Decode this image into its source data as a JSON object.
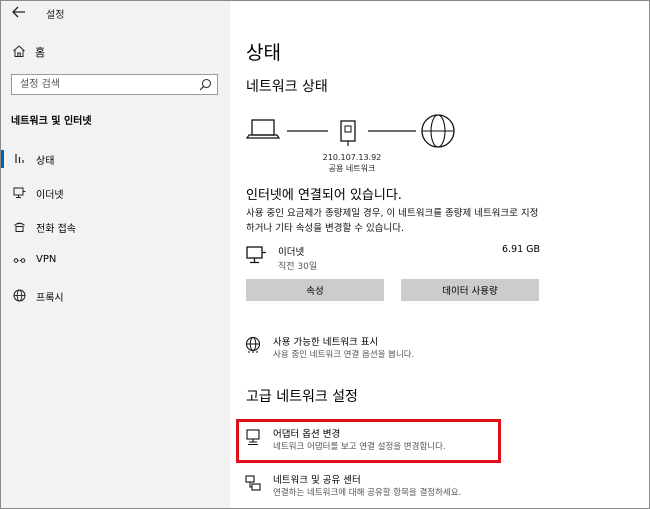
{
  "titlebar": {
    "title": "설정"
  },
  "sidebar": {
    "home_label": "홈",
    "search_placeholder": "설정 검색",
    "section_label": "네트워크 및 인터넷",
    "items": [
      {
        "label": "상태",
        "icon": "status-icon",
        "selected": true
      },
      {
        "label": "이더넷",
        "icon": "ethernet-icon"
      },
      {
        "label": "전화 접속",
        "icon": "dialup-icon"
      },
      {
        "label": "VPN",
        "icon": "vpn-icon"
      },
      {
        "label": "프록시",
        "icon": "globe-icon"
      }
    ]
  },
  "main": {
    "title": "상태",
    "network_status_heading": "네트워크 상태",
    "ip_address": "210.107.13.92",
    "network_type": "공용 네트워크",
    "status_title": "인터넷에 연결되어 있습니다.",
    "status_desc": "사용 중인 요금제가 종량제일 경우, 이 네트워크를 종량제 네트워크로 지정하거나 기타 속성을 변경할 수 있습니다.",
    "connection": {
      "name": "이더넷",
      "time": "직전 30일",
      "usage": "6.91 GB"
    },
    "buttons": {
      "properties": "속성",
      "data_usage": "데이터 사용량"
    },
    "show_networks": {
      "title": "사용 가능한 네트워크 표시",
      "desc": "사용 중인 네트워크 연결 옵션을 봅니다."
    },
    "advanced_heading": "고급 네트워크 설정",
    "adapter_options": {
      "title": "어댑터 옵션 변경",
      "desc": "네트워크 어댑터를 보고 연결 설정을 변경합니다."
    },
    "sharing_center": {
      "title": "네트워크 및 공유 센터",
      "desc": "연결하는 네트워크에 대해 공유할 항목을 결정하세요."
    }
  },
  "colors": {
    "accent": "#0063b1",
    "highlight": "#e0101a",
    "sidebar_bg": "#f2f2f2",
    "button_bg": "#cccccc"
  }
}
